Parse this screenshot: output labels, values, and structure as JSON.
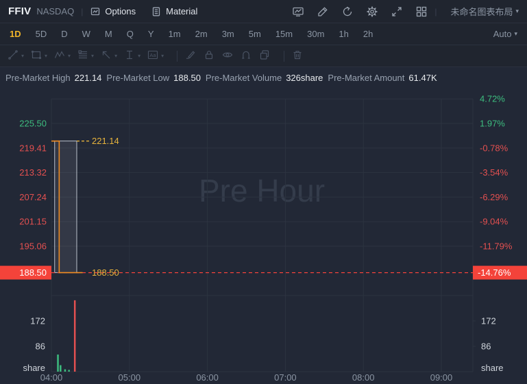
{
  "colors": {
    "bg": "#222836",
    "grid": "#2c3340",
    "up": "#3dbd7f",
    "down": "#e35050",
    "badge_bg": "#f4433a",
    "badge_text": "#ffffff",
    "accent_yellow": "#f0b429",
    "gold": "#e7b33c",
    "orange": "#f08c21",
    "text_dim": "#8b95a3",
    "watermark": "#343c4b",
    "box_stroke": "#bcc2cc"
  },
  "top_bar": {
    "symbol": "FFIV",
    "exchange": "NASDAQ",
    "options_label": "Options",
    "material_label": "Material",
    "layout_label": "未命名图表布局"
  },
  "timeframe_bar": {
    "items": [
      "1D",
      "5D",
      "D",
      "W",
      "M",
      "Q",
      "Y",
      "1m",
      "2m",
      "3m",
      "5m",
      "15m",
      "30m",
      "1h",
      "2h"
    ],
    "active": "1D",
    "auto_label": "Auto"
  },
  "info_bar": {
    "items": [
      {
        "label": "Pre-Market High",
        "value": "221.14"
      },
      {
        "label": "Pre-Market Low",
        "value": "188.50"
      },
      {
        "label": "Pre-Market Volume",
        "value": "326share"
      },
      {
        "label": "Pre-Market Amount",
        "value": "61.47K"
      }
    ]
  },
  "chart_data": {
    "type": "line",
    "session_watermark": "Pre Hour",
    "x_unit": "minutes after 04:00",
    "time_labels": [
      "04:00",
      "05:00",
      "06:00",
      "07:00",
      "08:00",
      "09:00"
    ],
    "price_series": {
      "name": "pre-market price",
      "points": [
        [
          0,
          221.14
        ],
        [
          6,
          221.14
        ],
        [
          6,
          188.5
        ],
        [
          24,
          188.5
        ]
      ]
    },
    "range_box": {
      "t1": 2.5,
      "t2": 19.5,
      "high": 221.14,
      "low": 188.5
    },
    "prev_close": {
      "price": 221.14,
      "label": "221.14"
    },
    "last_price": {
      "price": 188.5,
      "label": "188.50",
      "pct_label": "-14.76%"
    },
    "left_axis": [
      {
        "price": 225.5,
        "label": "225.50",
        "dir": "up"
      },
      {
        "price": 219.41,
        "label": "219.41",
        "dir": "down"
      },
      {
        "price": 213.32,
        "label": "213.32",
        "dir": "down"
      },
      {
        "price": 207.24,
        "label": "207.24",
        "dir": "down"
      },
      {
        "price": 201.15,
        "label": "201.15",
        "dir": "down"
      },
      {
        "price": 195.06,
        "label": "195.06",
        "dir": "down"
      }
    ],
    "right_axis": [
      {
        "price": 231.58,
        "label": "4.72%",
        "dir": "up"
      },
      {
        "price": 225.5,
        "label": "1.97%",
        "dir": "up"
      },
      {
        "price": 219.41,
        "label": "-0.78%",
        "dir": "down"
      },
      {
        "price": 213.32,
        "label": "-3.54%",
        "dir": "down"
      },
      {
        "price": 207.24,
        "label": "-6.29%",
        "dir": "down"
      },
      {
        "price": 201.15,
        "label": "-9.04%",
        "dir": "down"
      },
      {
        "price": 195.06,
        "label": "-11.79%",
        "dir": "down"
      }
    ],
    "volume_axis": {
      "ticks": [
        {
          "v": 172,
          "label": "172"
        },
        {
          "v": 86,
          "label": "86"
        }
      ],
      "unit_label": "share"
    },
    "volume_bars": [
      {
        "t": 5,
        "v": 58,
        "dir": "up"
      },
      {
        "t": 7,
        "v": 22,
        "dir": "up"
      },
      {
        "t": 10.5,
        "v": 8,
        "dir": "up"
      },
      {
        "t": 13.5,
        "v": 6,
        "dir": "up"
      },
      {
        "t": 18,
        "v": 242,
        "dir": "down"
      }
    ],
    "ylim": [
      186,
      233
    ],
    "grid": true
  }
}
